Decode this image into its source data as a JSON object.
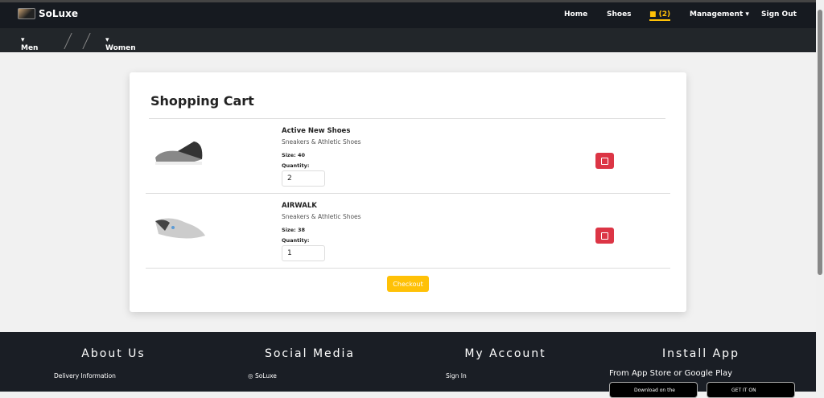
{
  "nav": {
    "brand": "SoLuxe",
    "home": "Home",
    "shoes": "Shoes",
    "cart_count": "(2)",
    "management": "Management",
    "sign_out": "Sign Out"
  },
  "subnav": {
    "men": "Men",
    "women": "Women"
  },
  "cart": {
    "title": "Shopping Cart",
    "size_label": "Size:",
    "quantity_label": "Quantity:",
    "checkout": "Checkout",
    "items": [
      {
        "name": "Active New Shoes",
        "category": "Sneakers & Athletic Shoes",
        "size": "Size: 40",
        "quantity": "2"
      },
      {
        "name": "AIRWALK",
        "category": "Sneakers & Athletic Shoes",
        "size": "Size: 38",
        "quantity": "1"
      }
    ]
  },
  "footer": {
    "about": "About Us",
    "social": "Social Media",
    "account": "My Account",
    "install": "Install App",
    "delivery": "Delivery Information",
    "instagram": "SoLuxe",
    "sign_in": "Sign In",
    "store_text": "From App Store or Google Play",
    "app_store": "Download on the",
    "google_play": "GET IT ON"
  },
  "colors": {
    "accent": "#ffc107",
    "danger": "#dc3545"
  }
}
